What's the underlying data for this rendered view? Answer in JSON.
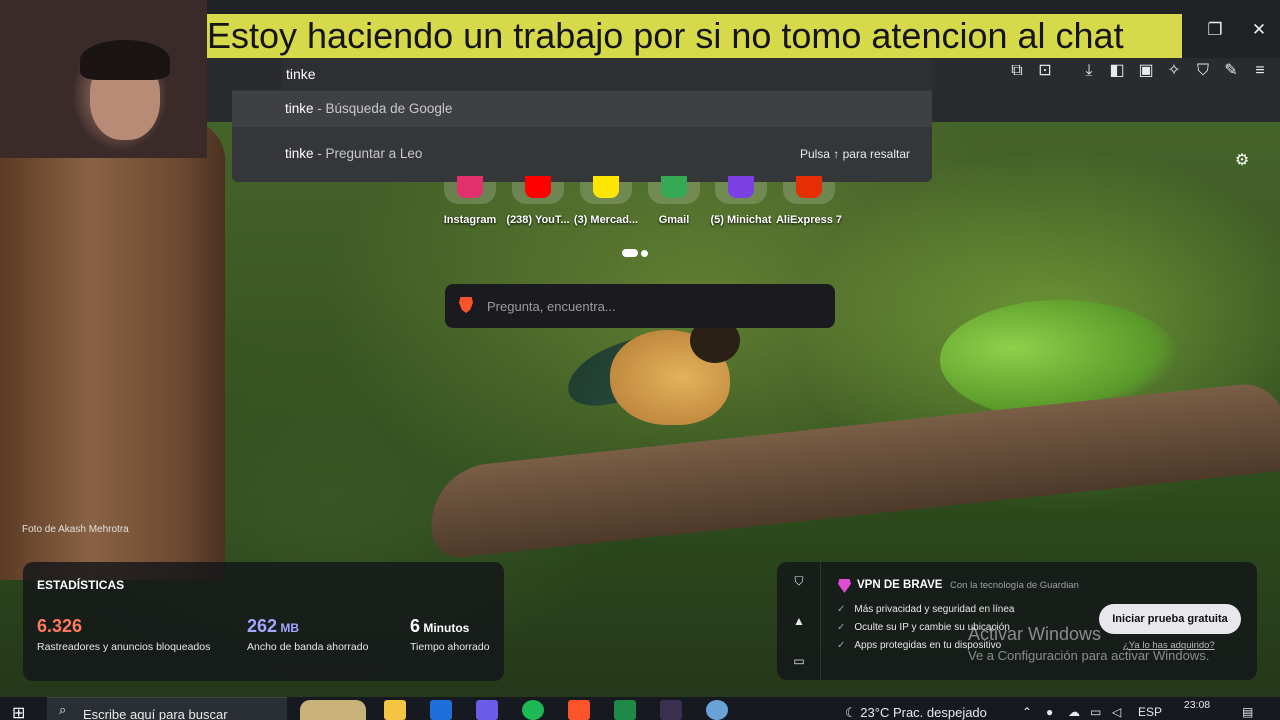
{
  "caption": "Estoy haciendo un trabajo por si no tomo atencion al chat",
  "omnibox": {
    "value": "tinke"
  },
  "suggestions": [
    {
      "query": "tinke",
      "description": " - Búsqueda de Google"
    },
    {
      "query": "tinke",
      "description": " - Preguntar a Leo",
      "hint": "Pulsa ↑ para resaltar"
    }
  ],
  "top_sites": [
    {
      "label": "Instagram",
      "color": "#e1306c"
    },
    {
      "label": "(238) YouT...",
      "color": "#ff0000"
    },
    {
      "label": "(3) Mercad...",
      "color": "#ffe600"
    },
    {
      "label": "Gmail",
      "color": "#34a853"
    },
    {
      "label": "(5) Minichat",
      "color": "#7b3fe4"
    },
    {
      "label": "AliExpress 7",
      "color": "#e62e04"
    }
  ],
  "search": {
    "placeholder": "Pregunta, encuentra..."
  },
  "photo_credit": "Foto de Akash Mehrotra",
  "stats": {
    "title": "ESTADÍSTICAS",
    "items": [
      {
        "value": "6.326",
        "unit": "",
        "desc": "Rastreadores y anuncios bloqueados",
        "color": "#ff7a5c"
      },
      {
        "value": "262",
        "unit": " MB",
        "desc": "Ancho de banda ahorrado",
        "color": "#a3a6ff"
      },
      {
        "value": "6",
        "unit": " Minutos",
        "desc": "Tiempo ahorrado",
        "color": "#ffffff"
      }
    ]
  },
  "vpn": {
    "title": "VPN DE BRAVE",
    "subtitle": "Con la tecnología de Guardian",
    "features": [
      "Más privacidad y seguridad en línea",
      "Oculte su IP y cambie su ubicación",
      "Apps protegidas en tu dispositivo"
    ],
    "button": "Iniciar prueba gratuita",
    "link": "¿Ya lo has adquirido?"
  },
  "activate": {
    "line1": "Activar Windows",
    "line2": "Ve a Configuración para activar Windows."
  },
  "taskbar": {
    "search_text": "Escribe aquí para buscar",
    "weather": "23°C  Prac. despejado",
    "lang": "ESP",
    "time": "23:08"
  }
}
